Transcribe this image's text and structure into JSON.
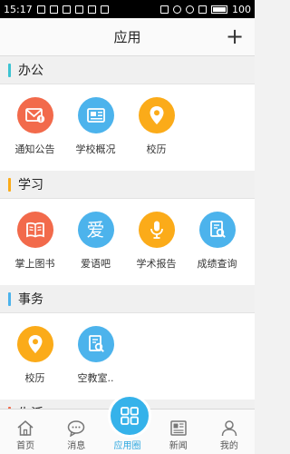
{
  "status_bar": {
    "time": "15:17",
    "battery": "100"
  },
  "header": {
    "title": "应用",
    "add_label": "+"
  },
  "sections": [
    {
      "title": "办公",
      "color": "#3dc3d2",
      "items": [
        {
          "label": "通知公告",
          "icon": "mail-alert-icon",
          "color": "#f26a4b"
        },
        {
          "label": "学校概况",
          "icon": "news-icon",
          "color": "#4cb3ec"
        },
        {
          "label": "校历",
          "icon": "location-pin-icon",
          "color": "#fbab19"
        }
      ]
    },
    {
      "title": "学习",
      "color": "#fbab19",
      "items": [
        {
          "label": "掌上图书",
          "icon": "book-icon",
          "color": "#f26a4b"
        },
        {
          "label": "爱语吧",
          "icon": "ai-character-icon",
          "glyph": "爱",
          "color": "#4cb3ec"
        },
        {
          "label": "学术报告",
          "icon": "microphone-icon",
          "color": "#fbab19"
        },
        {
          "label": "成绩查询",
          "icon": "document-search-icon",
          "color": "#4cb3ec"
        }
      ]
    },
    {
      "title": "事务",
      "color": "#4cb3ec",
      "items": [
        {
          "label": "校历",
          "icon": "location-pin-icon",
          "color": "#fbab19"
        },
        {
          "label": "空教室..",
          "icon": "document-search-icon",
          "color": "#4cb3ec"
        }
      ]
    },
    {
      "title": "生活",
      "color": "#f26a4b",
      "items": []
    }
  ],
  "tabbar": [
    {
      "label": "首页",
      "icon": "home-icon"
    },
    {
      "label": "消息",
      "icon": "chat-icon"
    },
    {
      "label": "应用圈",
      "icon": "apps-grid-icon",
      "active": true
    },
    {
      "label": "新闻",
      "icon": "newspaper-icon"
    },
    {
      "label": "我的",
      "icon": "person-icon"
    }
  ]
}
